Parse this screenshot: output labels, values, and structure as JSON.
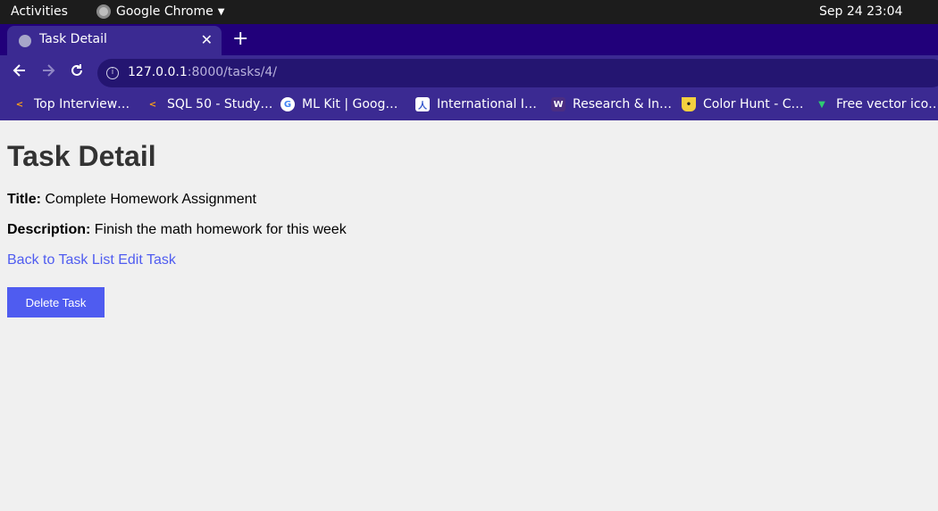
{
  "system": {
    "activities": "Activities",
    "app_name": "Google Chrome",
    "clock": "Sep 24  23:04"
  },
  "browser": {
    "tab_title": "Task Detail",
    "close_symbol": "✕",
    "newtab_symbol": "+",
    "url_host": "127.0.0.1",
    "url_rest": ":8000/tasks/4/",
    "bookmarks": [
      {
        "label": "Top Interview…",
        "icon": "leetcode-icon"
      },
      {
        "label": "SQL 50 - Study…",
        "icon": "leetcode-icon"
      },
      {
        "label": "ML Kit | Goog…",
        "icon": "google-icon"
      },
      {
        "label": "International I…",
        "icon": "figure-icon"
      },
      {
        "label": "Research & In…",
        "icon": "w-logo-icon"
      },
      {
        "label": "Color Hunt - C…",
        "icon": "colorhunt-icon"
      },
      {
        "label": "Free vector ico…",
        "icon": "vector-icon"
      }
    ]
  },
  "page": {
    "heading": "Task Detail",
    "title_label": "Title:",
    "title_value": "Complete Homework Assignment",
    "description_label": "Description:",
    "description_value": "Finish the math homework for this week",
    "back_link": "Back to Task List",
    "edit_link": "Edit Task",
    "delete_button": "Delete Task"
  },
  "colors": {
    "accent": "#4f5cf0",
    "tabstrip": "#21007a",
    "toolbar": "#3b2a92"
  }
}
